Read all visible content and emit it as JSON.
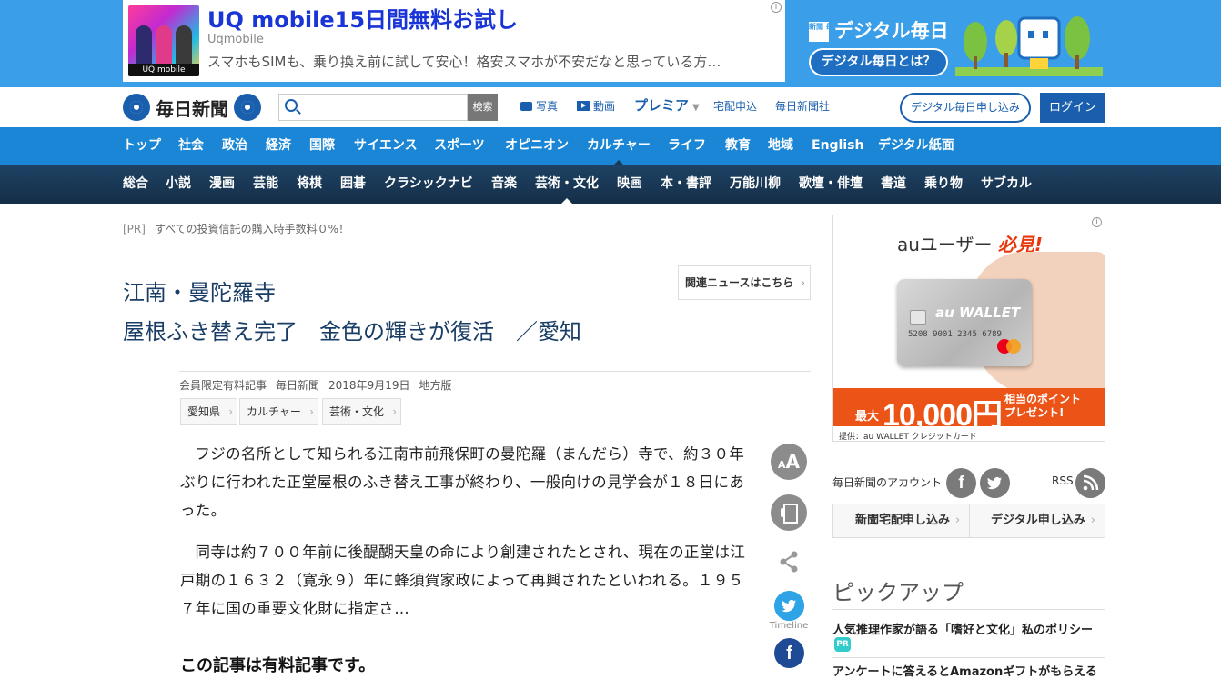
{
  "top_ad": {
    "title": "UQ mobile15日間無料お試し",
    "sponsor": "Uqmobile",
    "description": "スマホもSIMも、乗り換え前に試して安心！格安スマホが不安だなと思っている方…",
    "thumb_brand": "UQ mobile"
  },
  "digital_mainichi": {
    "logo_small": "新聞 毎日",
    "logo": "デジタル毎日",
    "about_button": "デジタル毎日とは？"
  },
  "header": {
    "logo": "毎日新聞",
    "search_placeholder": "",
    "search_button": "検索",
    "nav": {
      "photo": "写真",
      "video": "動画",
      "premier": "プレミア",
      "delivery": "宅配申込",
      "company": "毎日新聞社"
    },
    "subscribe_button": "デジタル毎日申し込み",
    "login_button": "ログイン"
  },
  "main_nav": [
    "トップ",
    "社会",
    "政治",
    "経済",
    "国際",
    "サイエンス",
    "スポーツ",
    "オピニオン",
    "カルチャー",
    "ライフ",
    "教育",
    "地域",
    "English",
    "デジタル紙面"
  ],
  "main_nav_active": "カルチャー",
  "sub_nav": [
    "総合",
    "小説",
    "漫画",
    "芸能",
    "将棋",
    "囲碁",
    "クラシックナビ",
    "音楽",
    "芸術・文化",
    "映画",
    "本・書評",
    "万能川柳",
    "歌壇・俳壇",
    "書道",
    "乗り物",
    "サブカル"
  ],
  "sub_nav_active": "芸術・文化",
  "pr": {
    "tag": "[PR]",
    "text": "すべての投資信託の購入時手数料０%！"
  },
  "article": {
    "title_line1": "江南・曼陀羅寺",
    "title_line2": "屋根ふき替え完了　金色の輝きが復活　／愛知",
    "related_button": "関連ニュースはこちら",
    "meta": {
      "type": "会員限定有料記事",
      "source": "毎日新聞",
      "date": "2018年9月19日",
      "edition": "地方版"
    },
    "tags": [
      "愛知県",
      "カルチャー",
      "芸術・文化"
    ],
    "paragraph1": "フジの名所として知られる江南市前飛保町の曼陀羅（まんだら）寺で、約３０年ぶりに行われた正堂屋根のふき替え工事が終わり、一般向けの見学会が１８日にあった。",
    "paragraph2": "同寺は約７００年前に後醍醐天皇の命により創建されたとされ、現在の正堂は江戸期の１６３２（寛永９）年に蜂須賀家政によって再興されたといわれる。１９５７年に国の重要文化財に指定さ…",
    "paywall": "この記事は有料記事です。"
  },
  "tools": {
    "font_small": "A",
    "font_big": "A",
    "twitter_label": "Timeline",
    "facebook_glyph": "f"
  },
  "side_ad": {
    "head_prefix": "auユーザー",
    "head_highlight": "必見!",
    "card_brand": "au WALLET",
    "card_number": "5208 9001 2345 6789",
    "promo_small": "最大",
    "promo_big": "10,000円",
    "promo_rest_1": "相当のポイント",
    "promo_rest_2": "プレゼント!",
    "footer": "提供：au WALLET クレジットカード"
  },
  "account": {
    "label": "毎日新聞のアカウント",
    "facebook": "f",
    "rss_label": "RSS"
  },
  "side_buttons": {
    "newspaper": "新聞宅配申し込み",
    "digital": "デジタル申し込み"
  },
  "pickup": {
    "title": "ピックアップ",
    "item1": "人気推理作家が語る「嗜好と文化」私のポリシー",
    "item1_badge": "PR",
    "item2": "アンケートに答えるとAmazonギフトがもらえる"
  },
  "colors": {
    "topbar": "#3a9ee8",
    "main_nav": "#1a86d5",
    "sub_nav": "#1e4264",
    "brand_blue": "#1a5fae",
    "title_text": "#1a3d66"
  }
}
